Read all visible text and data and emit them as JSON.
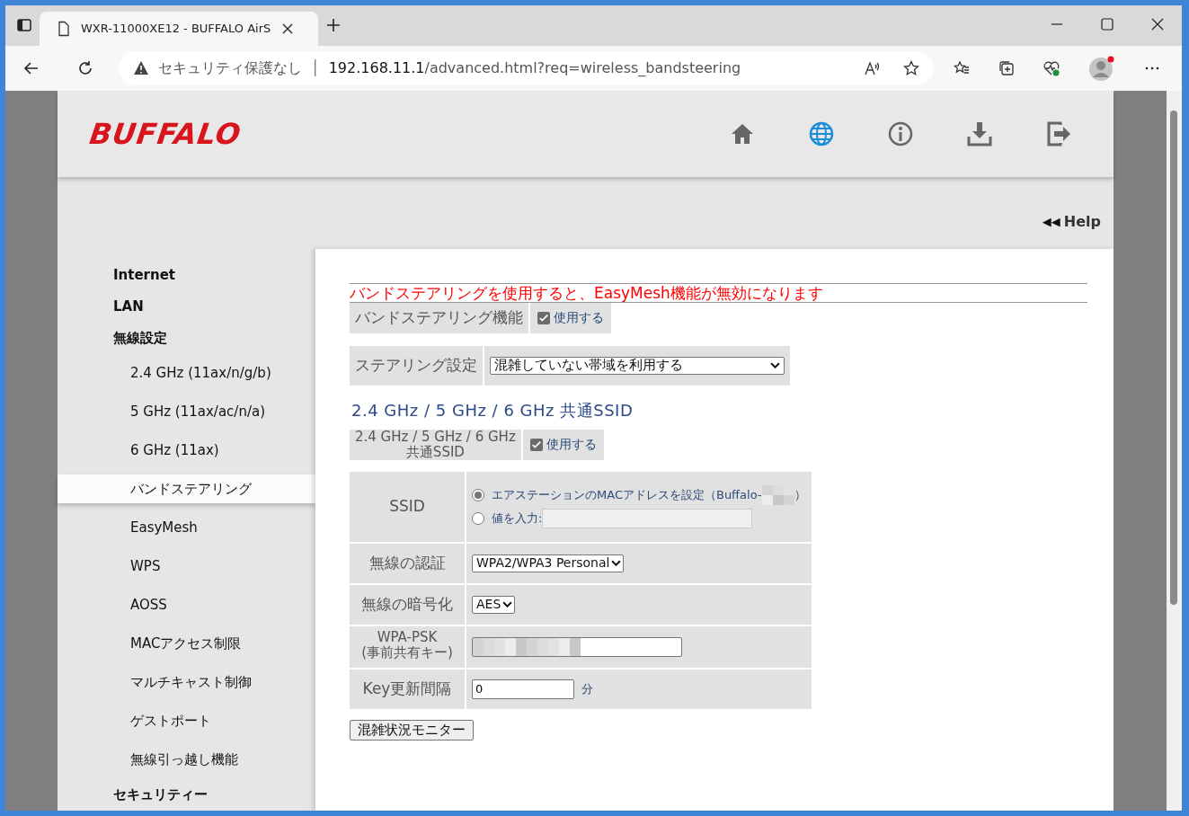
{
  "browser": {
    "tab_title": "WXR-11000XE12 - BUFFALO AirS",
    "security": "セキュリティ保護なし",
    "separator": "│",
    "url_host": "192.168.11.1",
    "url_path": "/advanced.html?req=wireless_bandsteering",
    "profile_notification": true
  },
  "header": {
    "logo": "BUFFALO",
    "icons": [
      {
        "kind": "home",
        "selected": false
      },
      {
        "kind": "globe",
        "selected": true
      },
      {
        "kind": "info",
        "selected": false
      },
      {
        "kind": "download",
        "selected": false
      },
      {
        "kind": "logout",
        "selected": false
      }
    ]
  },
  "help": {
    "arrows": "◀◀",
    "label": "Help"
  },
  "sidebar": {
    "items": [
      {
        "label": "Internet",
        "kind": "section",
        "selected": false
      },
      {
        "label": "LAN",
        "kind": "section",
        "selected": false
      },
      {
        "label": "無線設定",
        "kind": "section",
        "selected": false
      },
      {
        "label": "2.4 GHz (11ax/n/g/b)",
        "kind": "sub",
        "selected": false
      },
      {
        "label": "5 GHz (11ax/ac/n/a)",
        "kind": "sub",
        "selected": false
      },
      {
        "label": "6 GHz (11ax)",
        "kind": "sub",
        "selected": false
      },
      {
        "label": "バンドステアリング",
        "kind": "sub",
        "selected": true
      },
      {
        "label": "EasyMesh",
        "kind": "sub",
        "selected": false
      },
      {
        "label": "WPS",
        "kind": "sub",
        "selected": false
      },
      {
        "label": "AOSS",
        "kind": "sub",
        "selected": false
      },
      {
        "label": "MACアクセス制限",
        "kind": "sub",
        "selected": false
      },
      {
        "label": "マルチキャスト制御",
        "kind": "sub",
        "selected": false
      },
      {
        "label": "ゲストポート",
        "kind": "sub",
        "selected": false
      },
      {
        "label": "無線引っ越し機能",
        "kind": "sub",
        "selected": false
      },
      {
        "label": "セキュリティー",
        "kind": "section",
        "selected": false
      }
    ]
  },
  "main": {
    "warning": "バンドステアリングを使用すると、EasyMesh機能が無効になります",
    "band_steering": {
      "label": "バンドステアリング機能",
      "option": "使用する",
      "checked": true
    },
    "steering_setting": {
      "label": "ステアリング設定",
      "value": "混雑していない帯域を利用する"
    },
    "ssid_heading": "2.4 GHz / 5 GHz / 6 GHz 共通SSID",
    "common_ssid": {
      "label_lines": [
        "2.4 GHz / 5 GHz / 6 GHz",
        "共通SSID"
      ],
      "option": "使用する",
      "checked": true
    },
    "ssid": {
      "label": "SSID",
      "options": [
        {
          "label": "エアステーションのMACアドレスを設定（Buffalo-",
          "closing": "）",
          "kind": "mac",
          "selected": true
        },
        {
          "label": "値を入力:",
          "kind": "input",
          "selected": false
        }
      ]
    },
    "auth": {
      "label": "無線の認証",
      "value": "WPA2/WPA3 Personal"
    },
    "encryption": {
      "label": "無線の暗号化",
      "value": "AES"
    },
    "psk": {
      "label_lines": [
        "WPA-PSK",
        "(事前共有キー)"
      ]
    },
    "key_interval": {
      "label": "Key更新間隔",
      "value": "0",
      "unit": "分"
    },
    "monitor_button": "混雑状況モニター"
  }
}
